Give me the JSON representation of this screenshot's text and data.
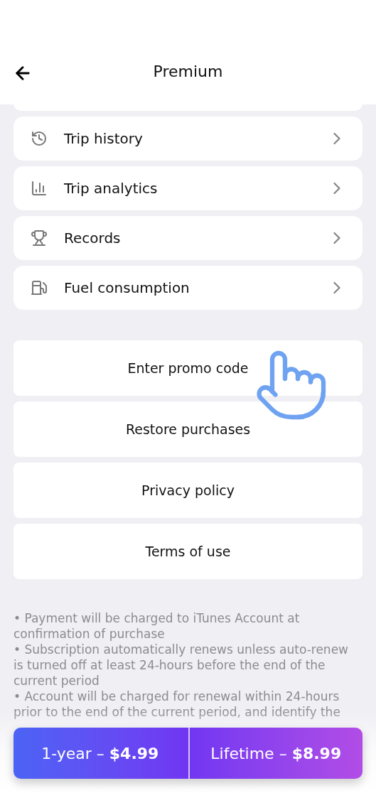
{
  "header": {
    "title": "Premium"
  },
  "menu": [
    {
      "kind": "history",
      "label": "Trip history"
    },
    {
      "kind": "chart",
      "label": "Trip analytics"
    },
    {
      "kind": "trophy",
      "label": "Records"
    },
    {
      "kind": "fuel",
      "label": "Fuel consumption"
    }
  ],
  "actions": [
    "Enter promo code",
    "Restore purchases",
    "Privacy policy",
    "Terms of use"
  ],
  "disclaimer": [
    "• Payment will be charged to iTunes Account at confirmation of purchase",
    "• Subscription automatically renews unless auto-renew is turned off at least 24-hours before the end of the current period",
    "• Account will be charged for renewal within 24-hours prior to the end of the current period, and identify the"
  ],
  "plans": [
    "1-year – **$4.99**",
    "Lifetime – **$8.99**"
  ]
}
